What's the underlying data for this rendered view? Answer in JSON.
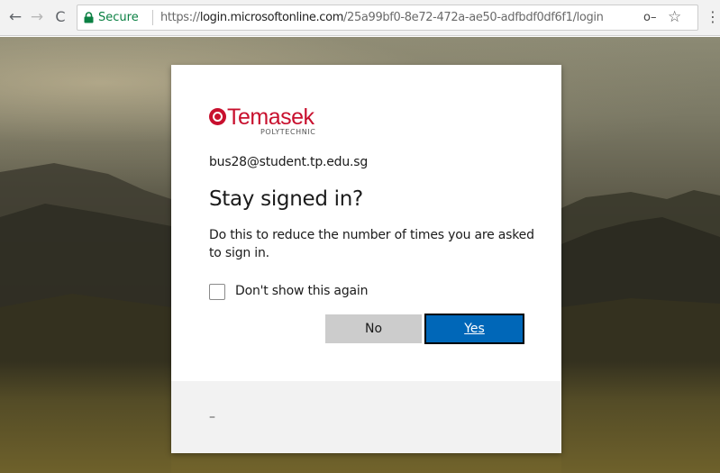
{
  "browser": {
    "back_icon": "←",
    "forward_icon": "→",
    "reload_icon": "C",
    "secure_label": "Secure",
    "url_scheme": "https://",
    "url_host": "login.microsoftonline.com",
    "url_path": "/25a99bf0-8e72-472a-ae50-adfbdf0df6f1/login",
    "key_icon": "o–",
    "star_icon": "☆",
    "menu_icon": "⋮"
  },
  "dialog": {
    "logo": {
      "word": "Temasek",
      "subtitle": "POLYTECHNIC",
      "color": "#c8102e"
    },
    "account": "bus28@student.tp.edu.sg",
    "title": "Stay signed in?",
    "description": "Do this to reduce the number of times you are asked to sign in.",
    "checkbox": {
      "label": "Don't show this again",
      "checked": false
    },
    "buttons": {
      "no": "No",
      "yes": "Yes"
    },
    "footer_text": "–"
  },
  "colors": {
    "primary_button": "#0067b8",
    "secondary_button": "#cccccc",
    "secure_green": "#0b8043",
    "footer_bg": "#f2f2f2"
  }
}
